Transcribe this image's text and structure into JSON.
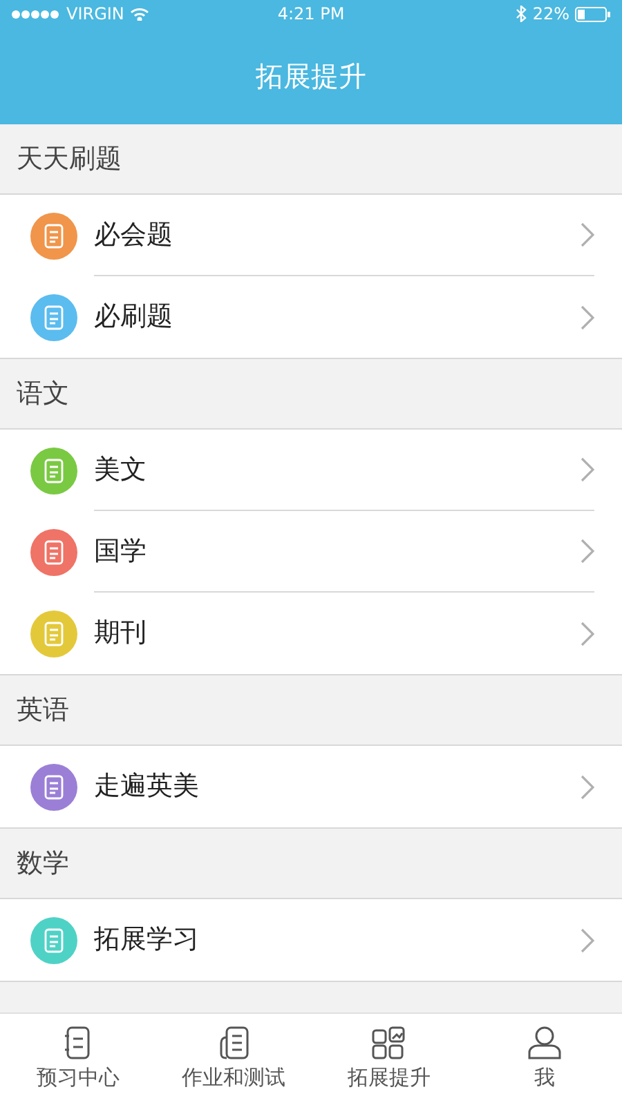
{
  "status_bar": {
    "carrier": "VIRGIN",
    "time": "4:21 PM",
    "battery": "22%"
  },
  "header": {
    "title": "拓展提升"
  },
  "sections": [
    {
      "title": "天天刷题",
      "items": [
        {
          "label": "必会题",
          "color": "#f0954a"
        },
        {
          "label": "必刷题",
          "color": "#5bbcef"
        }
      ]
    },
    {
      "title": "语文",
      "items": [
        {
          "label": "美文",
          "color": "#7ac943"
        },
        {
          "label": "国学",
          "color": "#ef7366"
        },
        {
          "label": "期刊",
          "color": "#e3c93a"
        }
      ]
    },
    {
      "title": "英语",
      "items": [
        {
          "label": "走遍英美",
          "color": "#9b7fd6"
        }
      ]
    },
    {
      "title": "数学",
      "items": [
        {
          "label": "拓展学习",
          "color": "#4fd2c6"
        }
      ]
    }
  ],
  "tab_bar": [
    {
      "label": "预习中心",
      "kind": "notebook"
    },
    {
      "label": "作业和测试",
      "kind": "list"
    },
    {
      "label": "拓展提升",
      "kind": "grid"
    },
    {
      "label": "我",
      "kind": "person"
    }
  ]
}
